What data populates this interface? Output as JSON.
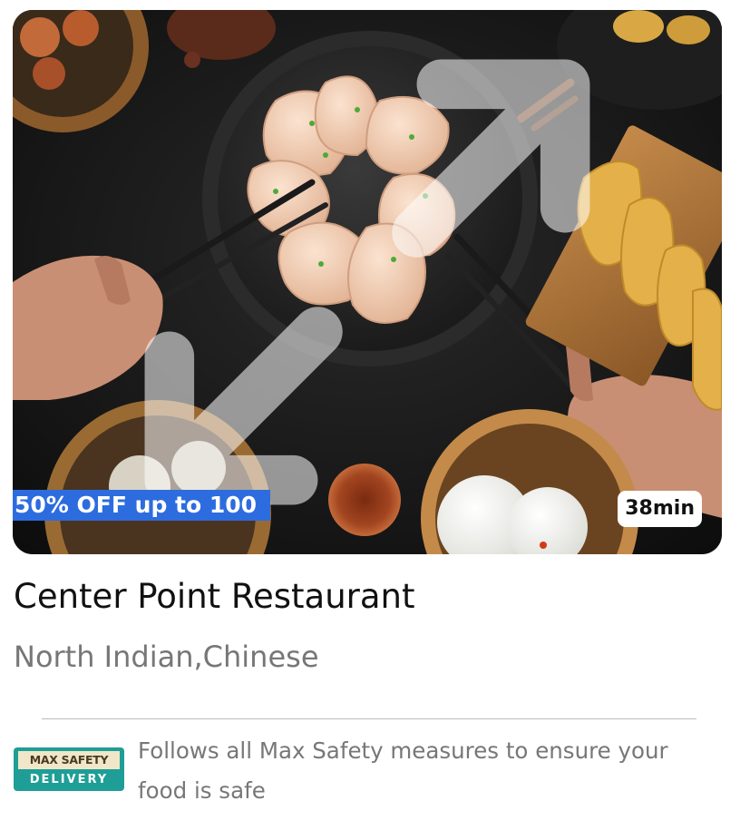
{
  "card": {
    "image_alt_icon": "dumplings-photo",
    "offer_badge": "50% OFF up to 100",
    "delivery_time": "38min",
    "name": "Center Point Restaurant",
    "cuisines": "North Indian,Chinese",
    "safety": {
      "logo_top": "MAX SAFETY",
      "logo_bottom": "DELIVERY",
      "text": "Follows all Max Safety measures to ensure your food is safe"
    }
  },
  "colors": {
    "offer_badge_bg": "#2d6cdf",
    "title": "#111111",
    "secondary_text": "#777777",
    "safety_logo_bg": "#1e9e96"
  }
}
